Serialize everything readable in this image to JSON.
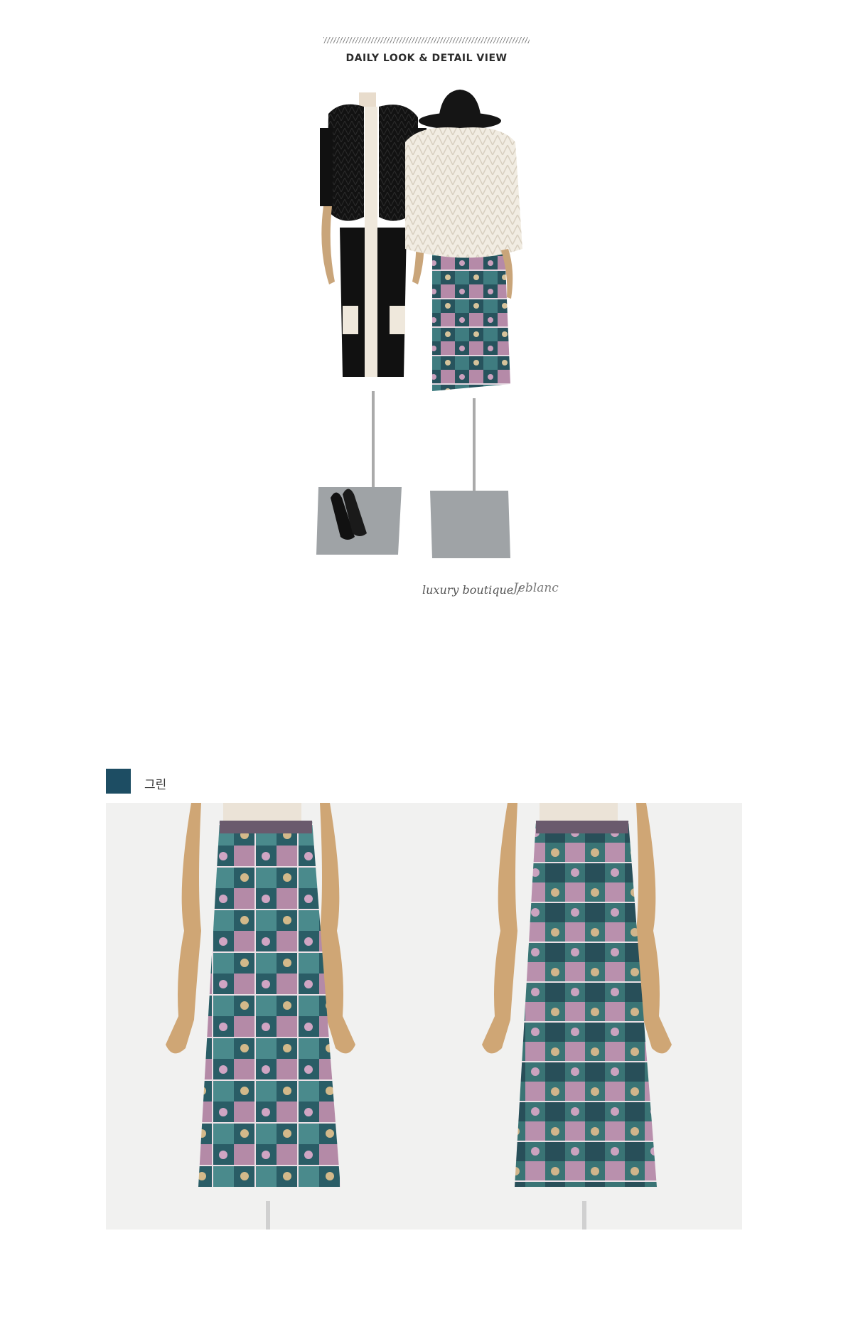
{
  "header": {
    "title": "DAILY LOOK & DETAIL VIEW"
  },
  "look": {
    "caption": "luxury boutique /",
    "signature": "Jeblanc"
  },
  "color_option": {
    "label": "그린",
    "swatch_color": "#1d4d63"
  },
  "detail_views": [
    {
      "name": "front-view"
    },
    {
      "name": "back-view"
    }
  ]
}
